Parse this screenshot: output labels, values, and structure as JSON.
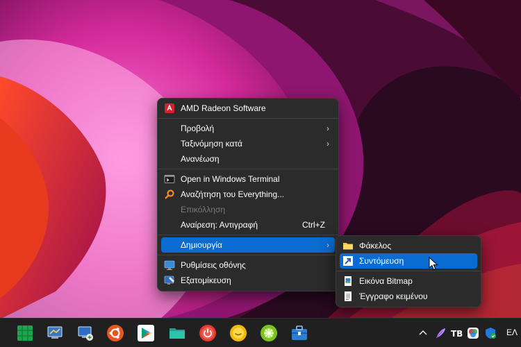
{
  "context_menu": {
    "items": [
      {
        "label": "AMD Radeon Software",
        "icon": "amd-radeon-icon"
      },
      {
        "label": "Προβολή",
        "submenu": true
      },
      {
        "label": "Ταξινόμηση κατά",
        "submenu": true
      },
      {
        "label": "Ανανέωση"
      },
      {
        "label": "Open in Windows Terminal",
        "icon": "terminal-icon"
      },
      {
        "label": "Αναζήτηση του Everything...",
        "icon": "everything-search-icon"
      },
      {
        "label": "Επικόλληση",
        "disabled": true
      },
      {
        "label": "Αναίρεση: Αντιγραφή",
        "shortcut": "Ctrl+Z"
      },
      {
        "label": "Δημιουργία",
        "submenu": true,
        "highlighted": true
      },
      {
        "label": "Ρυθμίσεις οθόνης",
        "icon": "display-settings-icon"
      },
      {
        "label": "Εξατομίκευση",
        "icon": "personalize-icon"
      }
    ]
  },
  "submenu": {
    "items": [
      {
        "label": "Φάκελος",
        "icon": "folder-icon"
      },
      {
        "label": "Συντόμευση",
        "icon": "shortcut-icon",
        "highlighted": true
      },
      {
        "label": "Εικόνα Bitmap",
        "icon": "bitmap-icon"
      },
      {
        "label": "Έγγραφο κειμένου",
        "icon": "text-document-icon"
      }
    ]
  },
  "taskbar": {
    "apps": [
      "app-green-icon",
      "control-panel-icon",
      "network-pc-icon",
      "ubuntu-icon",
      "play-store-icon",
      "file-explorer-icon",
      "power-app-icon",
      "yellow-app-icon",
      "green-app-icon",
      "toolbox-icon"
    ],
    "tray": [
      "chevron-up-icon",
      "feather-icon",
      "tb-icon",
      "color-app-icon",
      "security-shield-icon"
    ],
    "language": "ΕΛ"
  },
  "colors": {
    "menu_bg": "#2b2b2b",
    "highlight": "#0a6bd0",
    "taskbar_bg": "#202020"
  }
}
